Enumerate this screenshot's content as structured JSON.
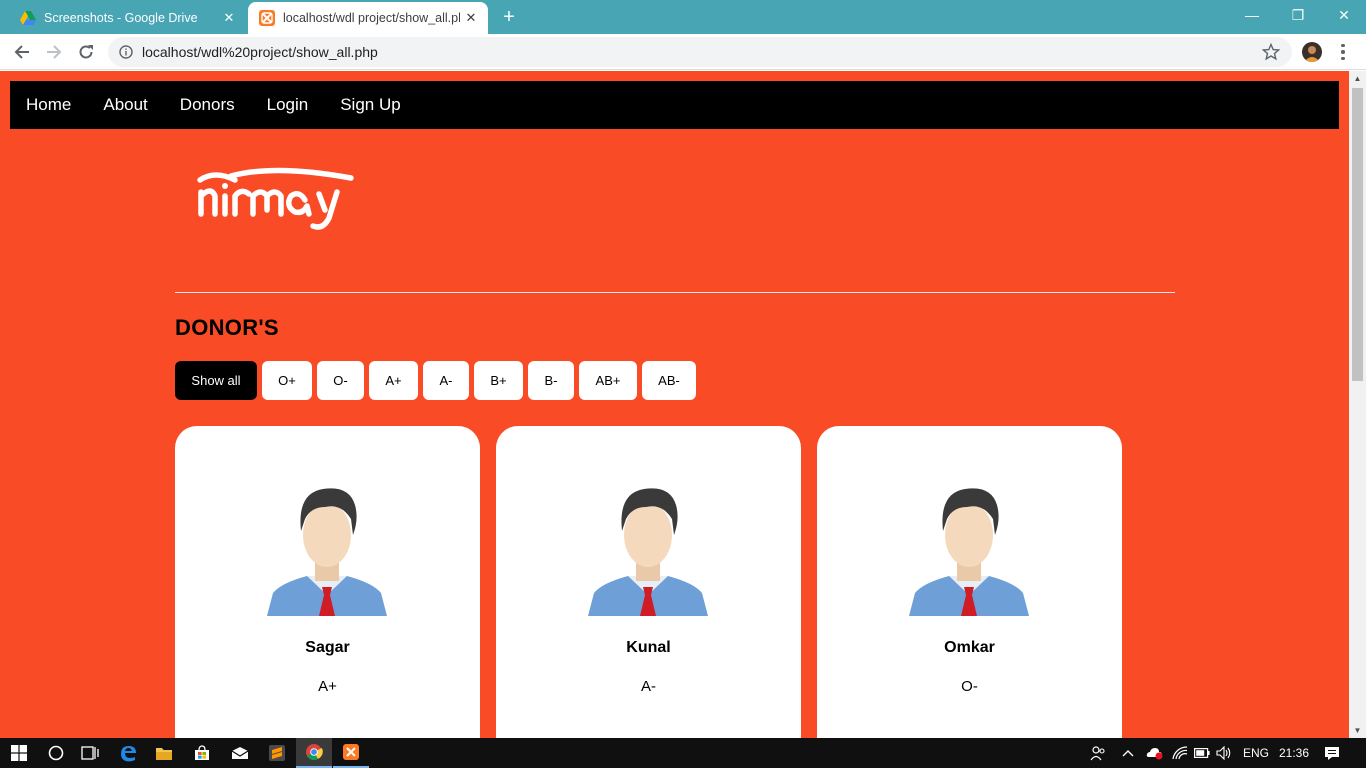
{
  "browser": {
    "tabs": [
      {
        "title": "Screenshots - Google Drive",
        "icon": "google-drive-icon",
        "active": false
      },
      {
        "title": "localhost/wdl project/show_all.php",
        "icon": "xampp-icon",
        "active": true
      }
    ],
    "new_tab_label": "+",
    "window_controls": {
      "minimize": "—",
      "restore": "❐",
      "close": "✕"
    },
    "url": "localhost/wdl%20project/show_all.php"
  },
  "site": {
    "nav": [
      "Home",
      "About",
      "Donors",
      "Login",
      "Sign Up"
    ],
    "logo_text": "nirmay",
    "heading": "DONOR'S",
    "filters": [
      {
        "label": "Show all",
        "active": true
      },
      {
        "label": "O+",
        "active": false
      },
      {
        "label": "O-",
        "active": false
      },
      {
        "label": "A+",
        "active": false
      },
      {
        "label": "A-",
        "active": false
      },
      {
        "label": "B+",
        "active": false
      },
      {
        "label": "B-",
        "active": false
      },
      {
        "label": "AB+",
        "active": false
      },
      {
        "label": "AB-",
        "active": false
      }
    ],
    "donors": [
      {
        "name": "Sagar",
        "blood_group": "A+"
      },
      {
        "name": "Kunal",
        "blood_group": "A-"
      },
      {
        "name": "Omkar",
        "blood_group": "O-"
      }
    ]
  },
  "colors": {
    "page_background": "#f94b26",
    "nav_background": "#000000",
    "tab_strip": "#47a5b4",
    "card_background": "#ffffff"
  },
  "taskbar": {
    "language": "ENG",
    "time": "21:36"
  }
}
